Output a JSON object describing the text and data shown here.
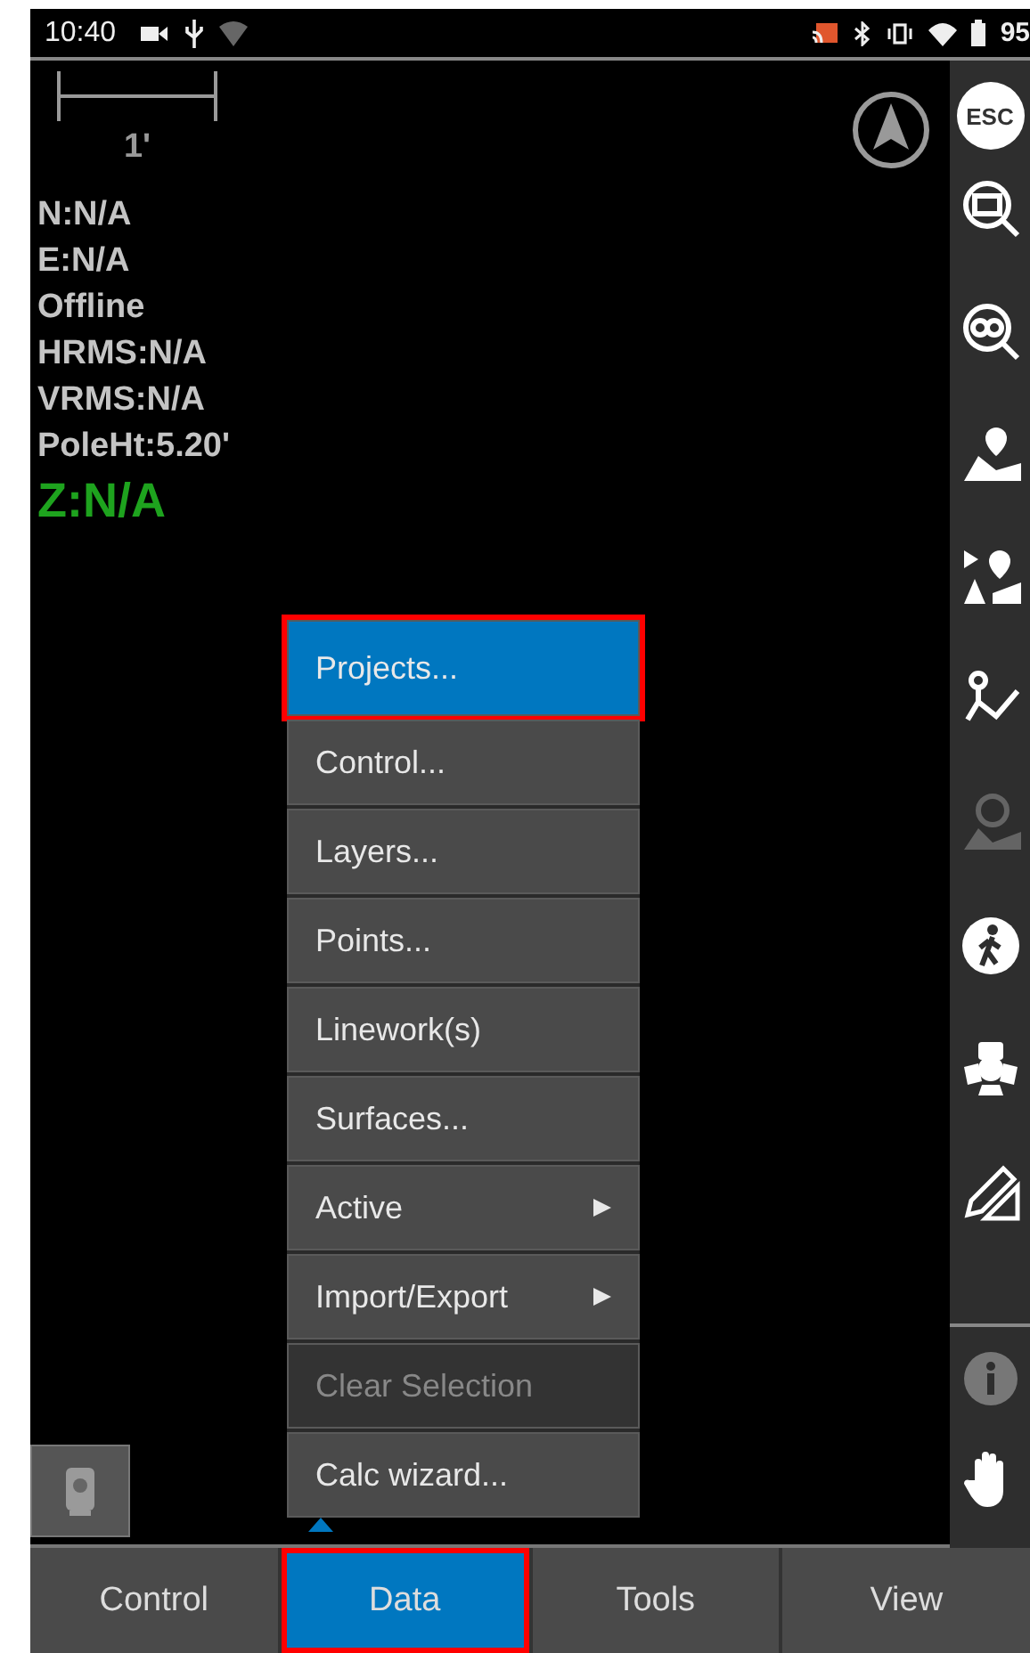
{
  "status_bar": {
    "time": "10:40",
    "battery": "95"
  },
  "map": {
    "scale_label": "1'",
    "readouts": [
      {
        "text": "N:N/A",
        "kind": "plain"
      },
      {
        "text": "E:N/A",
        "kind": "plain"
      },
      {
        "text": "Offline",
        "kind": "plain"
      },
      {
        "text": "HRMS:N/A",
        "kind": "plain"
      },
      {
        "text": "VRMS:N/A",
        "kind": "plain"
      },
      {
        "text": "PoleHt:5.20'",
        "kind": "plain"
      },
      {
        "text": "Z:N/A",
        "kind": "elevation"
      }
    ]
  },
  "toolbar": {
    "esc_label": "ESC",
    "tools": [
      {
        "kind": "zoom-extents",
        "disabled": false
      },
      {
        "kind": "zoom-all",
        "disabled": false
      },
      {
        "kind": "map-pin",
        "disabled": false
      },
      {
        "kind": "label-pin",
        "disabled": false
      },
      {
        "kind": "polyline",
        "disabled": false
      },
      {
        "kind": "target-map",
        "disabled": true
      },
      {
        "kind": "walk",
        "disabled": false
      },
      {
        "kind": "instrument",
        "disabled": false
      },
      {
        "kind": "pencil-ruler",
        "disabled": false
      }
    ],
    "bottom_tools": [
      {
        "kind": "info",
        "disabled": true
      },
      {
        "kind": "hand",
        "disabled": false
      }
    ]
  },
  "menu": {
    "items": [
      {
        "label": "Projects...",
        "selected": true,
        "disabled": false,
        "submenu": false
      },
      {
        "label": "Control...",
        "selected": false,
        "disabled": false,
        "submenu": false
      },
      {
        "label": "Layers...",
        "selected": false,
        "disabled": false,
        "submenu": false
      },
      {
        "label": "Points...",
        "selected": false,
        "disabled": false,
        "submenu": false
      },
      {
        "label": "Linework(s)",
        "selected": false,
        "disabled": false,
        "submenu": false
      },
      {
        "label": "Surfaces...",
        "selected": false,
        "disabled": false,
        "submenu": false
      },
      {
        "label": "Active",
        "selected": false,
        "disabled": false,
        "submenu": true
      },
      {
        "label": "Import/Export",
        "selected": false,
        "disabled": false,
        "submenu": true
      },
      {
        "label": "Clear Selection",
        "selected": false,
        "disabled": true,
        "submenu": false
      },
      {
        "label": "Calc wizard...",
        "selected": false,
        "disabled": false,
        "submenu": false
      }
    ]
  },
  "tabs": [
    {
      "label": "Control",
      "selected": false
    },
    {
      "label": "Data",
      "selected": true
    },
    {
      "label": "Tools",
      "selected": false
    },
    {
      "label": "View",
      "selected": false
    }
  ]
}
